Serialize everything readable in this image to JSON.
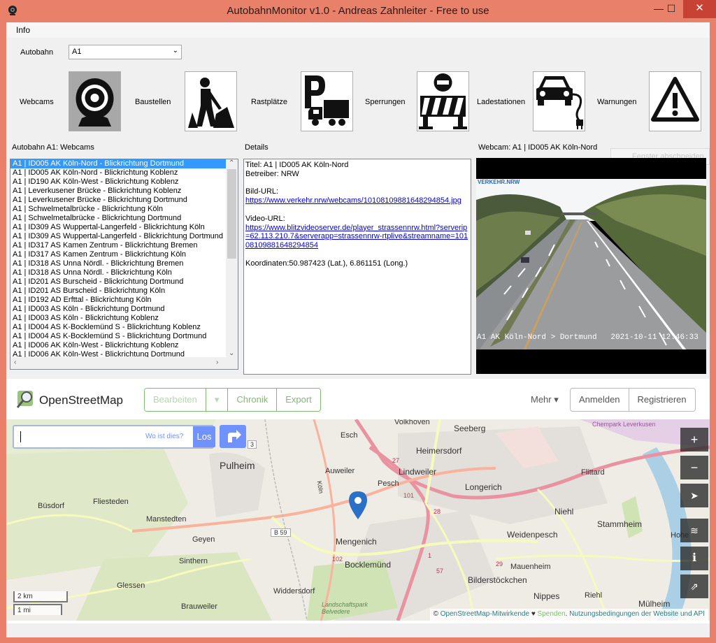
{
  "window": {
    "title": "AutobahnMonitor v1.0 - Andreas Zahnleiter - Free to use",
    "minimize": "—",
    "maximize": "☐",
    "close": "✕",
    "accent": "#e9816a"
  },
  "menu": {
    "info": "Info"
  },
  "autobahn": {
    "label": "Autobahn",
    "selected": "A1"
  },
  "categories": [
    {
      "label": "Webcams",
      "icon": "webcam-icon",
      "active": true
    },
    {
      "label": "Baustellen",
      "icon": "roadwork-icon"
    },
    {
      "label": "Rastplätze",
      "icon": "parking-truck-icon"
    },
    {
      "label": "Sperrungen",
      "icon": "road-closure-icon"
    },
    {
      "label": "Ladestationen",
      "icon": "charging-car-icon"
    },
    {
      "label": "Warnungen",
      "icon": "warning-icon"
    }
  ],
  "list": {
    "header": "Autobahn A1: Webcams",
    "items": [
      "A1 | ID005 AK Köln-Nord - Blickrichtung Dortmund",
      "A1 | ID005 AK Köln-Nord - Blickrichtung Koblenz",
      "A1 | ID190 AK Köln-West - Blickrichtung Koblenz",
      "A1 | Leverkusener Brücke - Blickrichtung Koblenz",
      "A1 | Leverkusener Brücke - Blickrichtung Dortmund",
      "A1 | Schwelmetalbrücke - Blickrichtung Köln",
      "A1 | Schwelmetalbrücke - Blickrichtung Dortmund",
      "A1 | ID309 AS Wuppertal-Langerfeld - Blickrichtung Köln",
      "A1 | ID309 AS Wuppertal-Langerfeld - Blickrichtung Dortmund",
      "A1 | ID317 AS Kamen Zentrum - Blickrichtung Bremen",
      "A1 | ID317 AS Kamen Zentrum - Blickrichtung Köln",
      "A1 | ID318 AS Unna Nördl. - Blickrichtung Bremen",
      "A1 | ID318 AS Unna Nördl. - Blickrichtung Köln",
      "A1 | ID201 AS Burscheid - Blickrichtung Dortmund",
      "A1 | ID201 AS Burscheid - Blickrichtung Köln",
      "A1 | ID192 AD Erfttal - Blickrichtung Köln",
      "A1 | ID003 AS Köln - Blickrichtung Dortmund",
      "A1 | ID003 AS Köln - Blickrichtung Koblenz",
      "A1 | ID004 AS K-Bocklemünd S - Blickrichtung Koblenz",
      "A1 | ID004 AS K-Bocklemünd S - Blickrichtung Dortmund",
      "A1 | ID006 AK Köln-West - Blickrichtung Koblenz",
      "A1 | ID006 AK Köln-West - Blickrichtung Dortmund"
    ],
    "selected_index": 0
  },
  "details": {
    "header": "Details",
    "title_line": "Titel: A1 | ID005 AK Köln-Nord",
    "operator_line": "Betreiber: NRW",
    "image_url_label": "Bild-URL:",
    "image_url": "https://www.verkehr.nrw/webcams/10108109881648294854.jpg",
    "video_url_label": "Video-URL:",
    "video_url": "https://www.blitzvideoserver.de/player_strassennrw.html?serverip=62.113.210.7&serverapp=strassennrw-rtplive&streamname=10108109881648294854",
    "coords_line": "Koordinaten:50.987423 (Lat.), 6.861151 (Long.)"
  },
  "camera": {
    "header": "Webcam: A1 | ID005 AK Köln-Nord",
    "logo": "VERKEHR.NRW",
    "overlay": "A1 AK Köln-Nord > Dortmund   2021-10-11 12:46:33",
    "ghost_button": "Fenster abschneiden"
  },
  "osm": {
    "brand": "OpenStreetMap",
    "edit": "Bearbeiten",
    "history": "Chronik",
    "export": "Export",
    "more": "Mehr",
    "login": "Anmelden",
    "register": "Registrieren",
    "search_hint": "Wo ist dies?",
    "go": "Los",
    "accent": "#7ebc6f",
    "scale_km": "2 km",
    "scale_mi": "1 mi",
    "attribution_prefix": "©",
    "attribution_contrib": "OpenStreetMap-Mitwirkende",
    "attribution_heart": "♥",
    "attribution_donate": "Spenden",
    "attribution_terms": "Nutzungsbedingungen der Website und API",
    "places": [
      "Volkhoven",
      "Seeberg",
      "Chempark Leverkusen",
      "Esch",
      "Heimersdorf",
      "Pulheim",
      "Auweiler",
      "Lindweiler",
      "Flittard",
      "Pesch",
      "Longerich",
      "Büsdorf",
      "Fliesteden",
      "Niehl",
      "Stammheim",
      "Manstedten",
      "Geyen",
      "Weidenpesch",
      "Mengenich",
      "Sinthern",
      "Bocklemünd",
      "Mauenheim",
      "Bilderstöckchen",
      "Glessen",
      "Nippes",
      "Riehl",
      "Widdersdorf",
      "Brauweiler",
      "Mülheim",
      "Landschaftspark Belvedere",
      "Köln",
      "Hohe"
    ],
    "road_labels": [
      "B 59",
      "27",
      "101",
      "28",
      "102",
      "3",
      "1",
      "57",
      "29"
    ]
  }
}
